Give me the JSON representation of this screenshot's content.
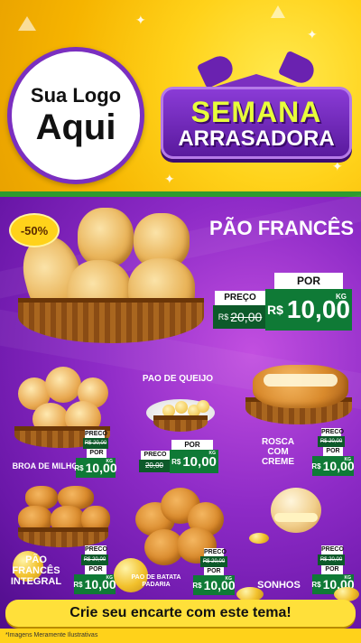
{
  "header": {
    "logo_line1": "Sua Logo",
    "logo_line2": "Aqui",
    "banner_line1": "SEMANA",
    "banner_line2": "ARRASADORA"
  },
  "featured": {
    "discount": "-50%",
    "title": "PÃO FRANCÊS",
    "por_label": "POR",
    "preco_label": "PREÇO",
    "old_currency": "R$",
    "old_price": "20,00",
    "currency": "R$",
    "price": "10,00",
    "unit": "KG"
  },
  "products": [
    {
      "name": "BROA DE MILHO",
      "preco_label": "PRECO",
      "old_price": "R$ 20,00",
      "por_label": "POR",
      "currency": "R$",
      "price": "10,00",
      "unit": "KG"
    },
    {
      "name": "PAO DE QUEIJO",
      "preco_label": "PRECO",
      "old_price": "20,00",
      "por_label": "POR",
      "currency": "R$",
      "price": "10,00",
      "unit": "KG"
    },
    {
      "name": "ROSCA COM CREME",
      "preco_label": "PRECO",
      "old_price": "R$ 20,00",
      "por_label": "POR",
      "currency": "R$",
      "price": "10,00",
      "unit": "KG"
    },
    {
      "name": "PÃO FRANCÊS INTEGRAL",
      "preco_label": "PRECO",
      "old_price": "R$ 20,00",
      "por_label": "POR",
      "currency": "R$",
      "price": "10,00",
      "unit": "KG"
    },
    {
      "name": "PAO DE BATATA PADARIA",
      "preco_label": "PRECO",
      "old_price": "R$ 20,00",
      "por_label": "POR",
      "currency": "R$",
      "price": "10,00",
      "unit": "KG"
    },
    {
      "name": "SONHOS",
      "preco_label": "PRECO",
      "old_price": "R$ 20,00",
      "por_label": "POR",
      "currency": "R$",
      "price": "10,00",
      "unit": "KG"
    }
  ],
  "cta_text": "Crie seu encarte com este tema!",
  "footer_note": "*Imagens Meramente Ilustrativas",
  "colors": {
    "yellow": "#ffd21a",
    "purple": "#7b2fc0",
    "price_green": "#0f7a36",
    "dark_green": "#0d5a2a"
  }
}
